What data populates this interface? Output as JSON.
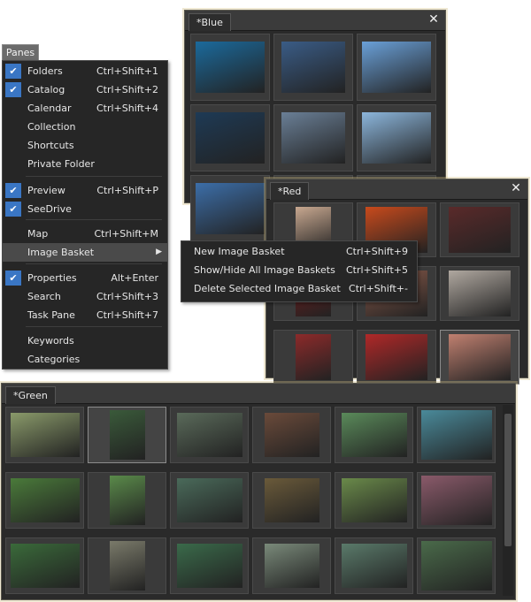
{
  "panes_button": "Panes",
  "menu": {
    "items": [
      {
        "label": "Folders",
        "shortcut": "Ctrl+Shift+1",
        "checked": true
      },
      {
        "label": "Catalog",
        "shortcut": "Ctrl+Shift+2",
        "checked": true
      },
      {
        "label": "Calendar",
        "shortcut": "Ctrl+Shift+4",
        "checked": false
      },
      {
        "label": "Collection",
        "shortcut": "",
        "checked": false
      },
      {
        "label": "Shortcuts",
        "shortcut": "",
        "checked": false
      },
      {
        "label": "Private Folder",
        "shortcut": "",
        "checked": false
      },
      {
        "label": "Preview",
        "shortcut": "Ctrl+Shift+P",
        "checked": true
      },
      {
        "label": "SeeDrive",
        "shortcut": "",
        "checked": true
      },
      {
        "label": "Map",
        "shortcut": "Ctrl+Shift+M",
        "checked": false
      },
      {
        "label": "Image Basket",
        "shortcut": "",
        "checked": false
      },
      {
        "label": "Properties",
        "shortcut": "Alt+Enter",
        "checked": true
      },
      {
        "label": "Search",
        "shortcut": "Ctrl+Shift+3",
        "checked": false
      },
      {
        "label": "Task Pane",
        "shortcut": "Ctrl+Shift+7",
        "checked": false
      },
      {
        "label": "Keywords",
        "shortcut": "",
        "checked": false
      },
      {
        "label": "Categories",
        "shortcut": "",
        "checked": false
      }
    ]
  },
  "submenu": {
    "items": [
      {
        "label": "New Image Basket",
        "shortcut": "Ctrl+Shift+9"
      },
      {
        "label": "Show/Hide All Image Baskets",
        "shortcut": "Ctrl+Shift+5"
      },
      {
        "label": "Delete Selected Image Basket",
        "shortcut": "Ctrl+Shift+-"
      }
    ]
  },
  "baskets": {
    "blue": {
      "title": "*Blue",
      "close": "✕",
      "thumbs": [
        "#1b6a9c",
        "#3a5c86",
        "#6aa0d8",
        "#1e3a55",
        "#6a7f96",
        "#8cb6dc",
        "#3c6ea8",
        "#5c7fa0",
        "#9cc8e8"
      ]
    },
    "red": {
      "title": "*Red",
      "close": "✕",
      "thumbs": [
        "#c8a890",
        "#c84a1c",
        "#5a2a2a",
        "#7a1c1c",
        "#8a5a4a",
        "#b0a8a0",
        "#8c2a2a",
        "#b02828",
        "#c08070"
      ]
    },
    "green": {
      "title": "*Green",
      "thumbs": [
        "#8a9a6a",
        "#3a5a3a",
        "#5a6a5a",
        "#6a4a3a",
        "#5a8a5a",
        "#4a8a9a",
        "#4a7a3a",
        "#5a8a4a",
        "#4a6a5a",
        "#6a5a3a",
        "#6a8a4a",
        "#8a5a6a",
        "#3a6a3a",
        "#7a7a6a",
        "#3a6a4a",
        "#7a8a7a",
        "#5a7a6a",
        "#4a6a4a"
      ]
    }
  },
  "colors": {
    "check_blue": "#3a76c4",
    "panel": "#2a2a2a",
    "menu": "#262626"
  }
}
